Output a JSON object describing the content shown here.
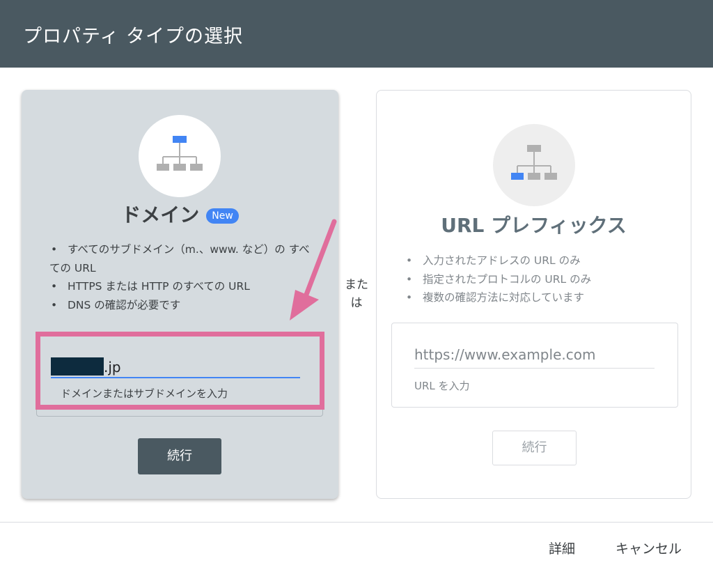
{
  "header": {
    "title": "プロパティ タイプの選択"
  },
  "domain_card": {
    "title": "ドメイン",
    "badge": "New",
    "features": [
      "すべてのサブドメイン（m.、www. など）の すべての URL",
      "HTTPS または HTTP のすべての URL",
      "DNS の確認が必要です"
    ],
    "input_value": ".jp",
    "input_helper": "ドメインまたはサブドメインを入力",
    "continue_label": "続行"
  },
  "separator": {
    "label": "また は"
  },
  "url_card": {
    "title": "URL プレフィックス",
    "features": [
      "入力されたアドレスの URL のみ",
      "指定されたプロトコルの URL のみ",
      "複数の確認方法に対応しています"
    ],
    "input_placeholder": "https://www.example.com",
    "input_helper": "URL を入力",
    "continue_label": "続行"
  },
  "footer": {
    "details_label": "詳細",
    "cancel_label": "キャンセル"
  },
  "colors": {
    "header_bg": "#4a5961",
    "accent_blue": "#4285f4",
    "highlight_pink": "#e06e9c",
    "selected_card_bg": "#d5dbdf"
  },
  "icons": {
    "domain_card": "sitemap-icon",
    "url_card": "sitemap-icon",
    "annotation": "arrow-icon"
  }
}
